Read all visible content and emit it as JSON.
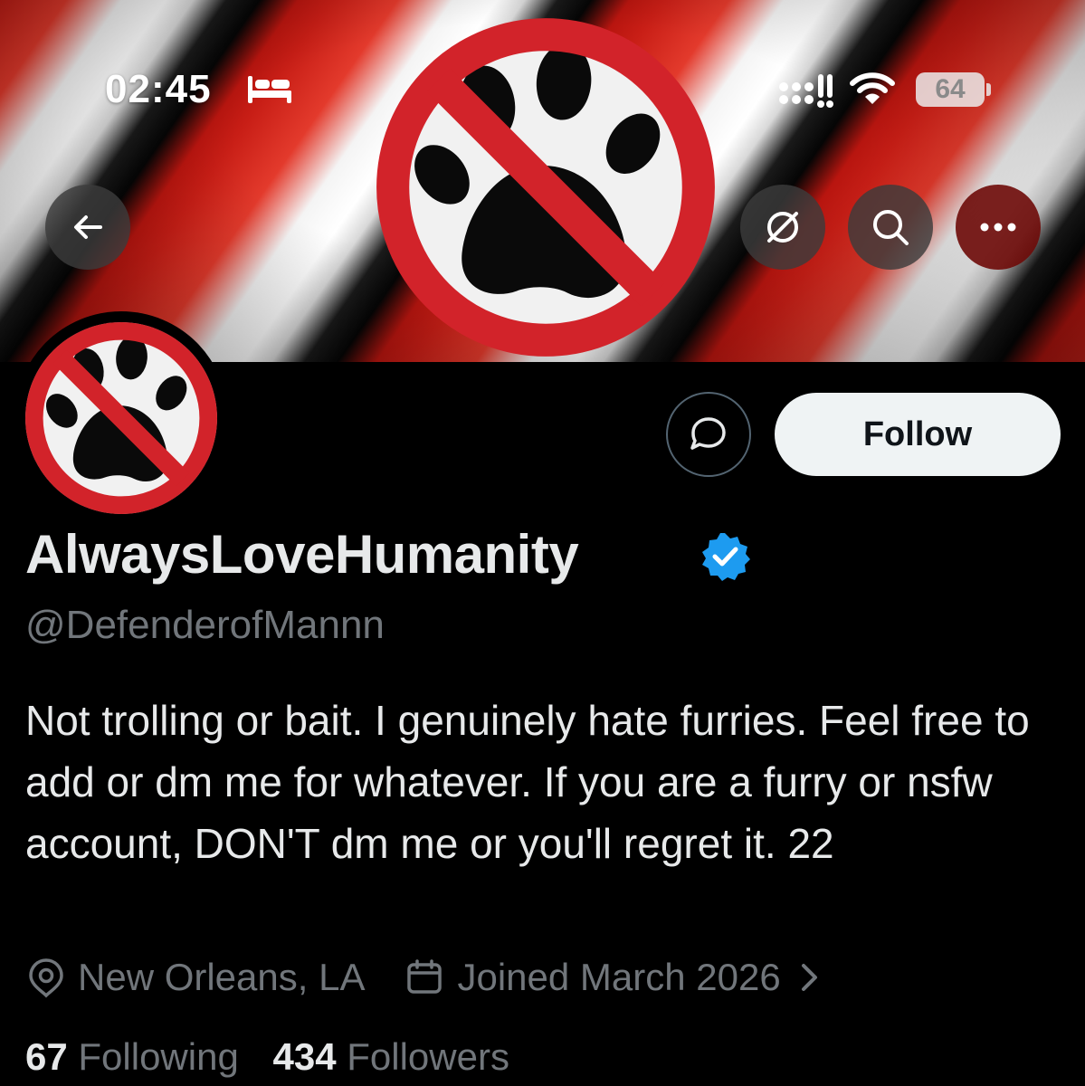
{
  "status_bar": {
    "time": "02:45",
    "battery": "64",
    "icons": [
      "bed-icon",
      "signal-icon",
      "wifi-icon",
      "battery-icon"
    ]
  },
  "header": {
    "banner": "no-paw-sign-banner",
    "buttons": [
      "back-arrow-icon",
      "grok-icon",
      "search-icon",
      "more-icon"
    ]
  },
  "profile": {
    "avatar": "no-paw-sign-avatar",
    "display_name": "AlwaysLoveHumanity",
    "verified": true,
    "verified_color": "#1d9bf0",
    "handle": "@DefenderofMannn",
    "bio": "Not trolling or bait. I genuinely hate furries. Feel free to add or dm me for whatever. If you are a furry or nsfw account, DON'T dm me or you'll regret it. 22",
    "location": "New Orleans, LA",
    "joined": "Joined March 2026",
    "following_count": "67",
    "following_label": "Following",
    "followers_count": "434",
    "followers_label": "Followers"
  },
  "actions": {
    "message_icon": "message-bubble-icon",
    "follow_label": "Follow"
  },
  "colors": {
    "background": "#000000",
    "text_primary": "#e7e9ea",
    "text_secondary": "#71767b",
    "sign_red": "#d2232a",
    "follow_button": "#eff3f4"
  }
}
